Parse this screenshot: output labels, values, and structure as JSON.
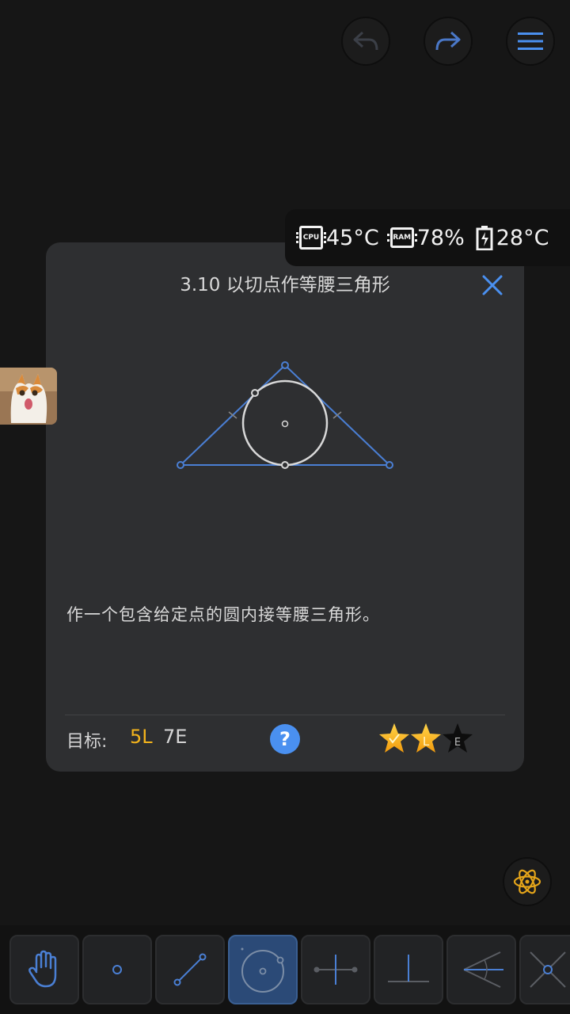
{
  "header": {
    "undo_icon": "undo-arrow-icon",
    "redo_icon": "redo-arrow-icon",
    "menu_icon": "hamburger-menu-icon"
  },
  "status": {
    "cpu_label": "CPU",
    "cpu_temp": "45°C",
    "ram_label": "RAM",
    "ram_usage": "78%",
    "battery_temp": "28°C"
  },
  "level": {
    "title": "3.10 以切点作等腰三角形",
    "description": "作一个包含给定点的圆内接等腰三角形。",
    "goal_label": "目标:",
    "goal_l": "5L",
    "goal_e": "7E",
    "help_label": "?",
    "stars": {
      "earned": 2,
      "total": 3,
      "star2_label": "L",
      "star3_label": "E"
    }
  },
  "toolbar": {
    "tools": [
      "hand-move-icon",
      "point-icon",
      "line-icon",
      "circle-icon",
      "perpendicular-bisector-icon",
      "perpendicular-icon",
      "angle-bisector-icon",
      "intersection-icon"
    ],
    "active_tool": "circle-icon"
  },
  "colors": {
    "accent": "#4a90f0",
    "gold": "#f4b41c",
    "panel": "#2e2f31",
    "background": "#161616"
  }
}
